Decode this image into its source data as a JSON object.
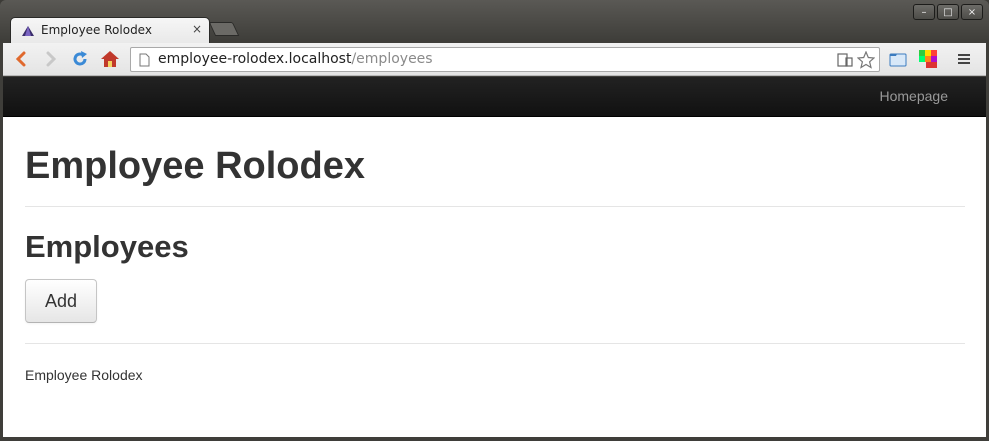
{
  "browser": {
    "tab_title": "Employee Rolodex",
    "tab_close_glyph": "×",
    "url_host": "employee-rolodex.localhost",
    "url_path": "/employees",
    "window_controls": [
      "–",
      "□",
      "×"
    ]
  },
  "site": {
    "nav_link": "Homepage",
    "title": "Employee Rolodex",
    "section_heading": "Employees",
    "add_button": "Add",
    "footer_text": "Employee Rolodex"
  },
  "icons": {
    "back": "back-arrow-icon",
    "forward": "forward-arrow-icon",
    "reload": "reload-icon",
    "home": "home-icon",
    "page": "page-icon",
    "bookmark": "star-icon",
    "menu": "hamburger-menu-icon"
  },
  "colors": {
    "navbar_bg": "#111111",
    "nav_link": "#999999",
    "heading": "#333333",
    "back_arrow": "#e0692d",
    "reload": "#3b8ad6",
    "home": "#c0392b"
  }
}
